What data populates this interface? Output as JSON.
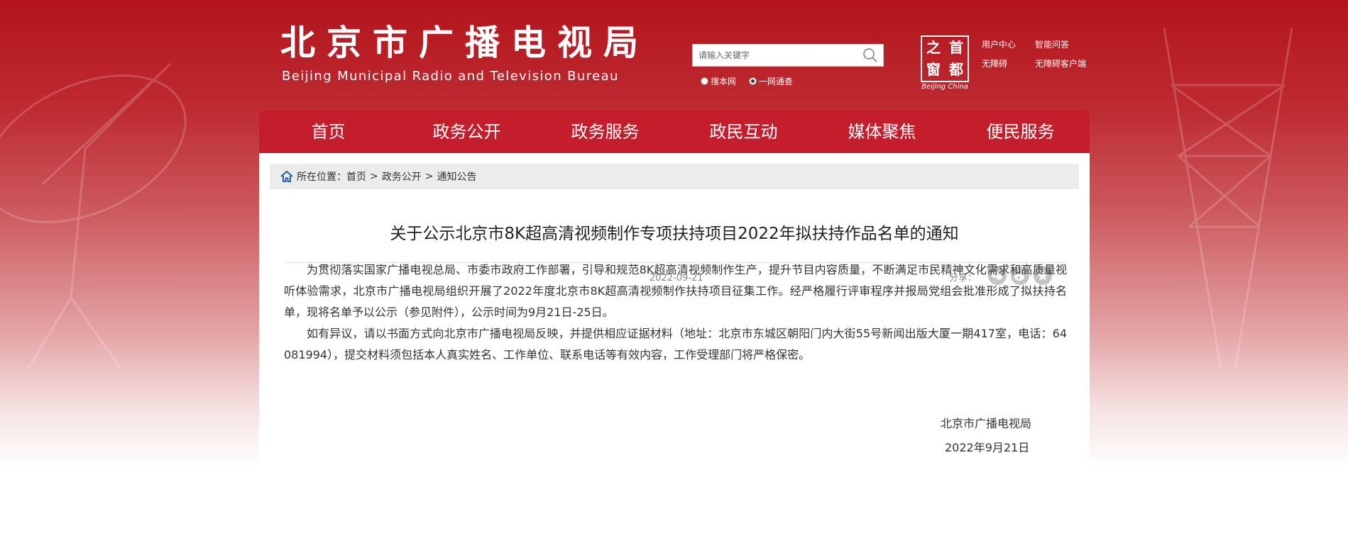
{
  "header": {
    "title": "北京市广播电视局",
    "subtitle": "Beijing Municipal Radio and Television Bureau",
    "search": {
      "placeholder": "请输入关键字",
      "options": [
        "搜本网",
        "一网通查"
      ],
      "selected": "一网通查"
    },
    "seal": {
      "chars": [
        "之",
        "首",
        "窗",
        "都"
      ],
      "caption": "Beijing China"
    },
    "links": [
      "用户中心",
      "智能问答",
      "无障碍",
      "无障碍客户端"
    ]
  },
  "nav": {
    "items": [
      "首页",
      "政务公开",
      "政务服务",
      "政民互动",
      "媒体聚焦",
      "便民服务"
    ]
  },
  "breadcrumb": {
    "label": "所在位置：",
    "items": [
      "首页",
      "政务公开",
      "通知公告"
    ],
    "separator": ">"
  },
  "article": {
    "title": "关于公示北京市8K超高清视频制作专项扶持项目2022年拟扶持作品名单的通知",
    "date": "2022-09-21",
    "share_label": "分享：",
    "share_icons": [
      "wechat-icon",
      "weibo-icon",
      "favorite-icon"
    ],
    "paragraphs": [
      "为贯彻落实国家广播电视总局、市委市政府工作部署，引导和规范8K超高清视频制作生产，提升节目内容质量，不断满足市民精神文化需求和高质量视听体验需求，北京市广播电视局组织开展了2022年度北京市8K超高清视频制作扶持项目征集工作。经严格履行评审程序并报局党组会批准形成了拟扶持名单，现将名单予以公示（参见附件），公示时间为9月21日-25日。",
      "如有异议，请以书面方式向北京市广播电视局反映，并提供相应证据材料（地址：北京市东城区朝阳门内大街55号新闻出版大厦一期417室，电话：64081994），提交材料须包括本人真实姓名、工作单位、联系电话等有效内容，工作受理部门将严格保密。"
    ],
    "signature": "北京市广播电视局",
    "sign_date": "2022年9月21日"
  },
  "colors": {
    "brand_red": "#c41e2d",
    "breadcrumb_bg": "#ececec",
    "share_icon_gray": "#c4c4c4"
  }
}
